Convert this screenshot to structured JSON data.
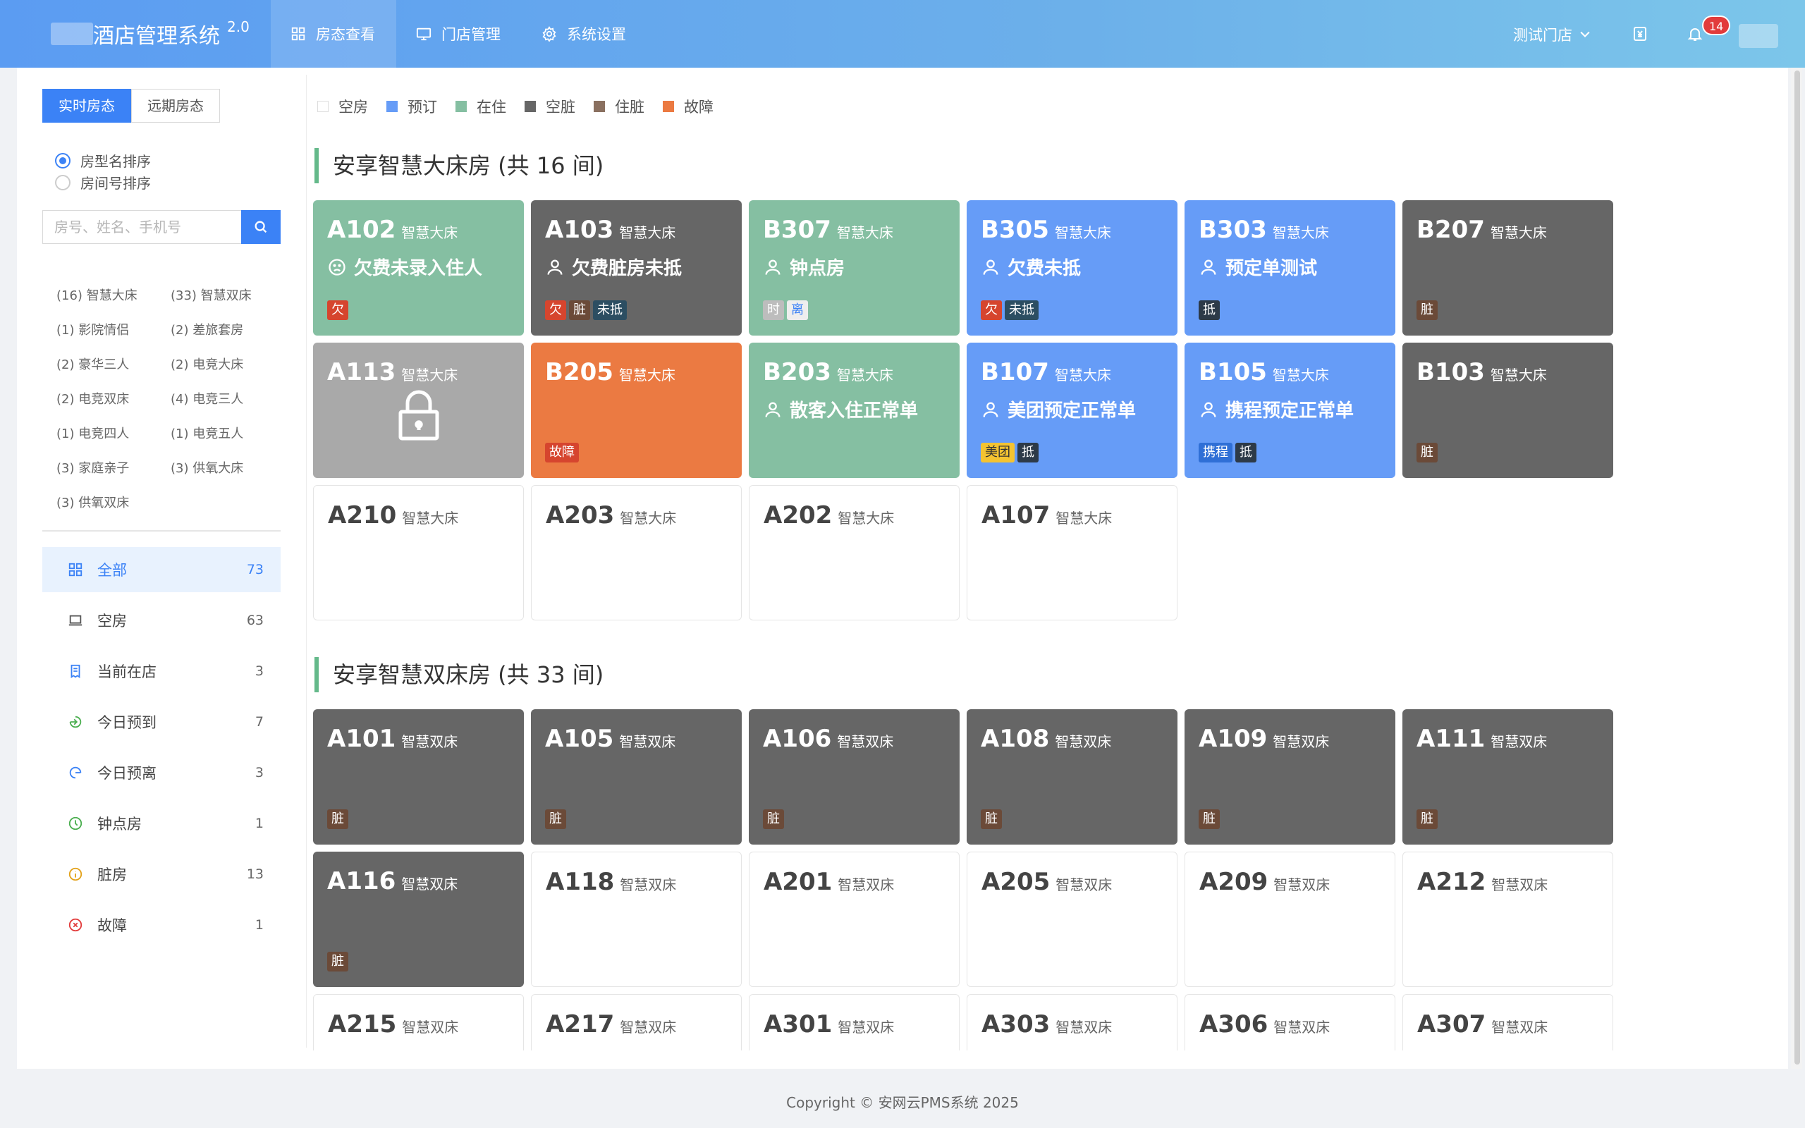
{
  "header": {
    "title": "酒店管理系统",
    "version": "2.0",
    "nav": [
      {
        "label": "房态查看",
        "active": true
      },
      {
        "label": "门店管理",
        "active": false
      },
      {
        "label": "系统设置",
        "active": false
      }
    ],
    "store": "测试门店",
    "notification_count": "14"
  },
  "sidebar": {
    "tabs": [
      "实时房态",
      "远期房态"
    ],
    "sort_options": [
      "房型名排序",
      "房间号排序"
    ],
    "search_placeholder": "房号、姓名、手机号",
    "room_types": [
      "(16) 智慧大床",
      "(33) 智慧双床",
      "(1) 影院情侣",
      "(2) 差旅套房",
      "(2) 豪华三人",
      "(2) 电竞大床",
      "(2) 电竞双床",
      "(4) 电竞三人",
      "(1) 电竞四人",
      "(1) 电竞五人",
      "(3) 家庭亲子",
      "(3) 供氧大床",
      "(3) 供氧双床"
    ],
    "filters": [
      {
        "label": "全部",
        "count": "73"
      },
      {
        "label": "空房",
        "count": "63"
      },
      {
        "label": "当前在店",
        "count": "3"
      },
      {
        "label": "今日预到",
        "count": "7"
      },
      {
        "label": "今日预离",
        "count": "3"
      },
      {
        "label": "钟点房",
        "count": "1"
      },
      {
        "label": "脏房",
        "count": "13"
      },
      {
        "label": "故障",
        "count": "1"
      }
    ]
  },
  "legend": [
    {
      "label": "空房",
      "color": "#ffffff"
    },
    {
      "label": "预订",
      "color": "#669cf7"
    },
    {
      "label": "在住",
      "color": "#85bfa2"
    },
    {
      "label": "空脏",
      "color": "#666666"
    },
    {
      "label": "住脏",
      "color": "#8a7060"
    },
    {
      "label": "故障",
      "color": "#eb7a42"
    }
  ],
  "sections": [
    {
      "title": "安享智慧大床房 (共 16 间)",
      "rooms": [
        {
          "no": "A102",
          "type": "智慧大床",
          "status": "stay",
          "guest": "欠费未录入住人",
          "guest_icon": "sad-face",
          "tags": [
            {
              "t": "欠",
              "k": "qian"
            }
          ]
        },
        {
          "no": "A103",
          "type": "智慧大床",
          "status": "dirty",
          "guest": "欠费脏房未抵",
          "guest_icon": "user",
          "tags": [
            {
              "t": "欠",
              "k": "qian"
            },
            {
              "t": "脏",
              "k": "zang"
            },
            {
              "t": "未抵",
              "k": "wei"
            }
          ]
        },
        {
          "no": "B307",
          "type": "智慧大床",
          "status": "stay",
          "guest": "钟点房",
          "guest_icon": "user",
          "tags": [
            {
              "t": "时",
              "k": "shi"
            },
            {
              "t": "离",
              "k": "li"
            }
          ]
        },
        {
          "no": "B305",
          "type": "智慧大床",
          "status": "reserve",
          "guest": "欠费未抵",
          "guest_icon": "user",
          "tags": [
            {
              "t": "欠",
              "k": "qian"
            },
            {
              "t": "未抵",
              "k": "wei"
            }
          ]
        },
        {
          "no": "B303",
          "type": "智慧大床",
          "status": "reserve",
          "guest": "预定单测试",
          "guest_icon": "user",
          "tags": [
            {
              "t": "抵",
              "k": "di"
            }
          ]
        },
        {
          "no": "B207",
          "type": "智慧大床",
          "status": "dirty",
          "guest": "",
          "tags": [
            {
              "t": "脏",
              "k": "zang"
            }
          ]
        },
        {
          "no": "A113",
          "type": "智慧大床",
          "status": "locked",
          "guest": "",
          "tags": []
        },
        {
          "no": "B205",
          "type": "智慧大床",
          "status": "fault",
          "guest": "",
          "tags": [
            {
              "t": "故障",
              "k": "fault"
            }
          ]
        },
        {
          "no": "B203",
          "type": "智慧大床",
          "status": "stay",
          "guest": "散客入住正常单",
          "guest_icon": "user",
          "tags": []
        },
        {
          "no": "B107",
          "type": "智慧大床",
          "status": "reserve",
          "guest": "美团预定正常单",
          "guest_icon": "user",
          "tags": [
            {
              "t": "美团",
              "k": "meituan"
            },
            {
              "t": "抵",
              "k": "di"
            }
          ]
        },
        {
          "no": "B105",
          "type": "智慧大床",
          "status": "reserve",
          "guest": "携程预定正常单",
          "guest_icon": "user",
          "tags": [
            {
              "t": "携程",
              "k": "ctrip"
            },
            {
              "t": "抵",
              "k": "di"
            }
          ]
        },
        {
          "no": "B103",
          "type": "智慧大床",
          "status": "dirty",
          "guest": "",
          "tags": [
            {
              "t": "脏",
              "k": "zang"
            }
          ]
        },
        {
          "no": "A210",
          "type": "智慧大床",
          "status": "vacant",
          "guest": "",
          "tags": []
        },
        {
          "no": "A203",
          "type": "智慧大床",
          "status": "vacant",
          "guest": "",
          "tags": []
        },
        {
          "no": "A202",
          "type": "智慧大床",
          "status": "vacant",
          "guest": "",
          "tags": []
        },
        {
          "no": "A107",
          "type": "智慧大床",
          "status": "vacant",
          "guest": "",
          "tags": []
        }
      ]
    },
    {
      "title": "安享智慧双床房 (共 33 间)",
      "rooms": [
        {
          "no": "A101",
          "type": "智慧双床",
          "status": "dirty",
          "guest": "",
          "tags": [
            {
              "t": "脏",
              "k": "zang"
            }
          ]
        },
        {
          "no": "A105",
          "type": "智慧双床",
          "status": "dirty",
          "guest": "",
          "tags": [
            {
              "t": "脏",
              "k": "zang"
            }
          ]
        },
        {
          "no": "A106",
          "type": "智慧双床",
          "status": "dirty",
          "guest": "",
          "tags": [
            {
              "t": "脏",
              "k": "zang"
            }
          ]
        },
        {
          "no": "A108",
          "type": "智慧双床",
          "status": "dirty",
          "guest": "",
          "tags": [
            {
              "t": "脏",
              "k": "zang"
            }
          ]
        },
        {
          "no": "A109",
          "type": "智慧双床",
          "status": "dirty",
          "guest": "",
          "tags": [
            {
              "t": "脏",
              "k": "zang"
            }
          ]
        },
        {
          "no": "A111",
          "type": "智慧双床",
          "status": "dirty",
          "guest": "",
          "tags": [
            {
              "t": "脏",
              "k": "zang"
            }
          ]
        },
        {
          "no": "A116",
          "type": "智慧双床",
          "status": "dirty",
          "guest": "",
          "tags": [
            {
              "t": "脏",
              "k": "zang"
            }
          ]
        },
        {
          "no": "A118",
          "type": "智慧双床",
          "status": "vacant",
          "guest": "",
          "tags": []
        },
        {
          "no": "A201",
          "type": "智慧双床",
          "status": "vacant",
          "guest": "",
          "tags": []
        },
        {
          "no": "A205",
          "type": "智慧双床",
          "status": "vacant",
          "guest": "",
          "tags": []
        },
        {
          "no": "A209",
          "type": "智慧双床",
          "status": "vacant",
          "guest": "",
          "tags": []
        },
        {
          "no": "A212",
          "type": "智慧双床",
          "status": "vacant",
          "guest": "",
          "tags": []
        },
        {
          "no": "A215",
          "type": "智慧双床",
          "status": "vacant",
          "guest": "",
          "tags": []
        },
        {
          "no": "A217",
          "type": "智慧双床",
          "status": "vacant",
          "guest": "",
          "tags": []
        },
        {
          "no": "A301",
          "type": "智慧双床",
          "status": "vacant",
          "guest": "",
          "tags": []
        },
        {
          "no": "A303",
          "type": "智慧双床",
          "status": "vacant",
          "guest": "",
          "tags": []
        },
        {
          "no": "A306",
          "type": "智慧双床",
          "status": "vacant",
          "guest": "",
          "tags": []
        },
        {
          "no": "A307",
          "type": "智慧双床",
          "status": "vacant",
          "guest": "",
          "tags": []
        }
      ]
    }
  ],
  "footer": "Copyright © 安网云PMS系统 2025"
}
